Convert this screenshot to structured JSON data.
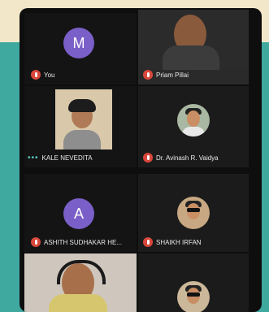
{
  "participants": [
    {
      "initial": "M",
      "name": "You"
    },
    {
      "name": "Priam Pillai"
    },
    {
      "name": "KALE NEVEDITA"
    },
    {
      "name": "Dr. Avinash R. Vaidya"
    },
    {
      "initial": "A",
      "name": "ASHITH SUDHAKAR HE..."
    },
    {
      "name": "SHAIKH IRFAN"
    }
  ],
  "colors": {
    "page_background": "#3fa9a0",
    "top_band": "#f3e7c9",
    "avatar_purple": "#7b5fc8",
    "muted_red": "#d9473b"
  }
}
